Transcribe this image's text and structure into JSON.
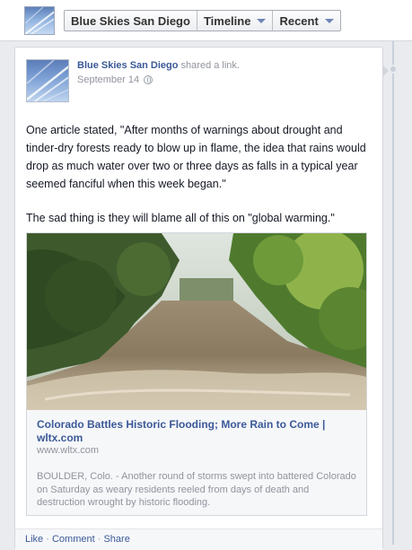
{
  "header": {
    "page_name": "Blue Skies San Diego",
    "timeline_label": "Timeline",
    "recent_label": "Recent"
  },
  "post": {
    "author": "Blue Skies San Diego",
    "action_text": "shared a link.",
    "date": "September 14",
    "paragraphs": [
      "One article stated, \"After months of warnings about drought and tinder-dry forests ready to blow up in flame, the idea that rains would drop as much water over two or three days as falls in a typical year seemed fanciful when this week began.\"",
      "The sad thing is they will blame all of this on \"global warming.\""
    ],
    "link": {
      "title": "Colorado Battles Historic Flooding; More Rain to Come | wltx.com",
      "domain": "www.wltx.com",
      "description": "BOULDER, Colo. - Another round of storms swept into battered Colorado on Saturday as weary residents reeled from days of death and destruction wrought by historic flooding."
    },
    "actions": {
      "like": "Like",
      "comment": "Comment",
      "share": "Share",
      "separator": "·"
    }
  },
  "colors": {
    "link_blue": "#3b5998",
    "meta_gray": "#90949c",
    "background": "#e9ebee"
  },
  "icons": {
    "privacy": "globe-icon",
    "dropdown": "chevron-down-icon"
  }
}
